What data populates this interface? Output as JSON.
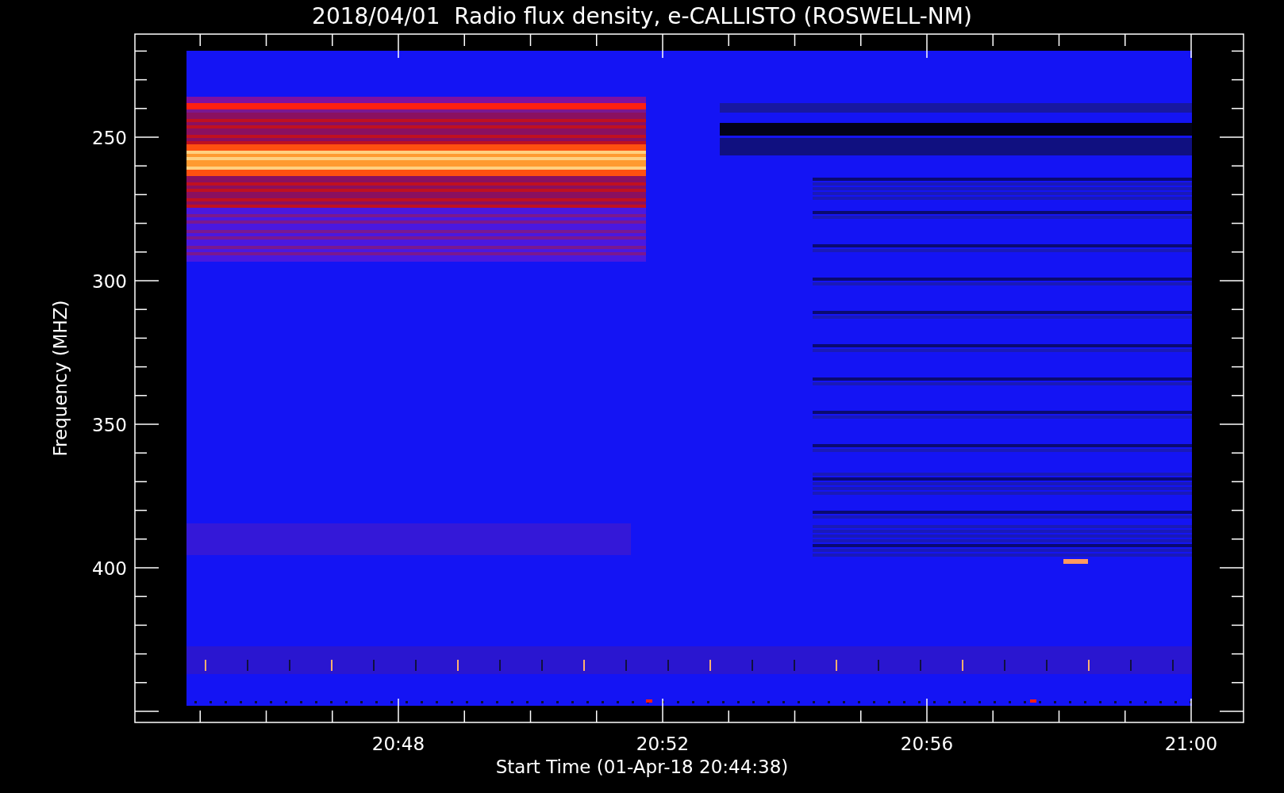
{
  "plot": {
    "title": "2018/04/01  Radio flux density, e-CALLISTO (ROSWELL-NM)",
    "y_axis": {
      "label": "Frequency (MHZ)",
      "ticks": [
        "250",
        "300",
        "350",
        "400"
      ]
    },
    "x_axis": {
      "label": "Start Time (01-Apr-18 20:44:38)",
      "ticks": [
        "20:48",
        "20:52",
        "20:56",
        "21:00"
      ]
    }
  }
}
